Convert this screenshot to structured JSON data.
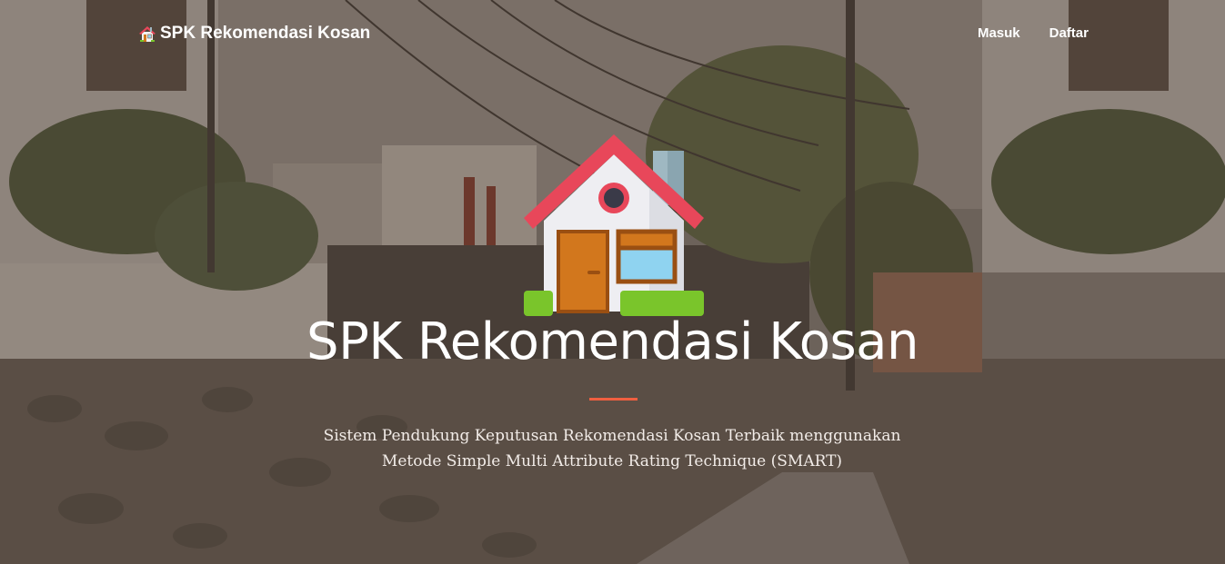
{
  "navbar": {
    "brand_label": "SPK Rekomendasi Kosan",
    "brand_icon": "house-icon",
    "links": [
      {
        "label": "Masuk"
      },
      {
        "label": "Daftar"
      }
    ]
  },
  "hero": {
    "icon": "house-icon",
    "title": "SPK Rekomendasi Kosan",
    "subtitle_line1": "Sistem Pendukung Keputusan Rekomendasi Kosan Terbaik menggunakan",
    "subtitle_line2": "Metode Simple Multi Attribute Rating Technique (SMART)",
    "divider_color": "#f05f40"
  }
}
